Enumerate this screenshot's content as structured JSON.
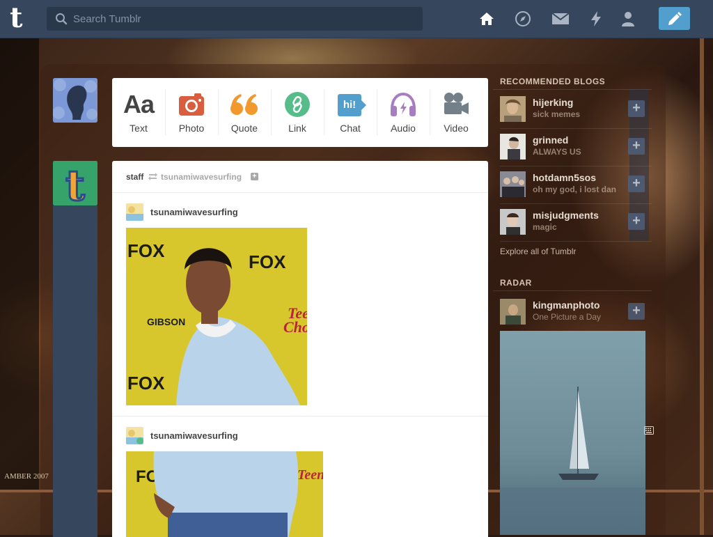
{
  "topbar": {
    "logo": "t",
    "search_placeholder": "Search Tumblr",
    "icons": [
      "home-icon",
      "explore-compass-icon",
      "mail-icon",
      "activity-lightning-icon",
      "account-person-icon",
      "compose-pencil-icon"
    ]
  },
  "background": {
    "watermark": "AMBER 2007"
  },
  "post_types": [
    {
      "label": "Text",
      "glyph": "Aa",
      "color": "#444444",
      "icon": "text-aa-icon"
    },
    {
      "label": "Photo",
      "color": "#d95e40",
      "icon": "camera-icon"
    },
    {
      "label": "Quote",
      "glyph": "66",
      "color": "#f2992e",
      "icon": "quote-icon"
    },
    {
      "label": "Link",
      "color": "#56bc8a",
      "icon": "link-icon"
    },
    {
      "label": "Chat",
      "glyph": "hi!",
      "color": "#529ecc",
      "icon": "chat-bubble-icon"
    },
    {
      "label": "Audio",
      "color": "#a77dc2",
      "icon": "headphones-icon"
    },
    {
      "label": "Video",
      "color": "#748089",
      "icon": "video-camera-icon"
    }
  ],
  "post": {
    "reblogger": "staff",
    "source": "tsunamiwavesurfing",
    "entries": [
      {
        "author": "tsunamiwavesurfing"
      },
      {
        "author": "tsunamiwavesurfing"
      }
    ]
  },
  "sidebar": {
    "recommended_heading": "RECOMMENDED BLOGS",
    "blogs": [
      {
        "name": "hijerking",
        "desc": "sick memes",
        "color": "#9a8466"
      },
      {
        "name": "grinned",
        "desc": "ALWAYS US",
        "color": "#dcdad4"
      },
      {
        "name": "hotdamn5sos",
        "desc": "oh my god, i lost dan",
        "color": "#6a6a72"
      },
      {
        "name": "misjudgments",
        "desc": "magic",
        "color": "#b8b8b8"
      }
    ],
    "explore_link": "Explore all of Tumblr",
    "radar_heading": "RADAR",
    "radar": {
      "name": "kingmanphoto",
      "desc": "One Picture a Day",
      "color": "#8a7a5a"
    }
  }
}
